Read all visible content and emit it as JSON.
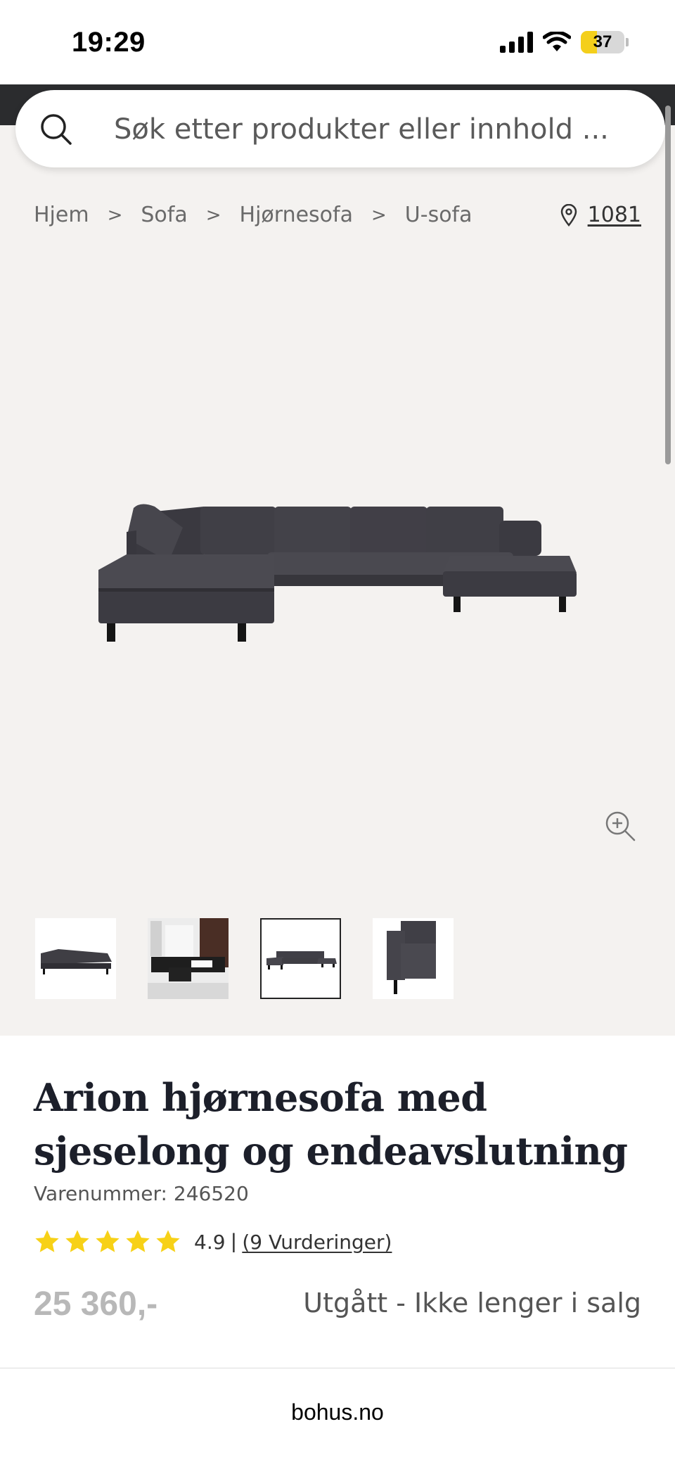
{
  "status_bar": {
    "time": "19:29",
    "battery": "37",
    "battery_level": 0.37,
    "icons": [
      "signal-icon",
      "wifi-icon",
      "battery-icon"
    ]
  },
  "search": {
    "placeholder": "Søk etter produkter eller innhold ...",
    "icon": "search-icon"
  },
  "breadcrumb": {
    "items": [
      "Hjem",
      "Sofa",
      "Hjørnesofa",
      "U-sofa"
    ],
    "separator": ">"
  },
  "store": {
    "label": "1081",
    "icon": "location-pin-icon"
  },
  "gallery": {
    "main_image": "dark-grey-u-sofa",
    "zoom_icon": "zoom-in-icon",
    "thumbnails": [
      "thumb-sofa-side",
      "thumb-livingroom",
      "thumb-sofa-front",
      "thumb-sofa-detail"
    ],
    "selected_index": 2
  },
  "product": {
    "title": "Arion hjørnesofa med sjeselong og endeavslutning",
    "sku": "Varenummer: 246520",
    "rating_value": "4.9",
    "rating_separator": "|",
    "rating_stars": 5,
    "review_link": "(9 Vurderinger)",
    "price": "25 360,-",
    "availability": "Utgått - Ikke lenger i salg"
  },
  "browser": {
    "url": "bohus.no"
  },
  "colors": {
    "header_dark": "#2b2c2e",
    "gallery_bg": "#f4f2f0",
    "star": "#f7d117",
    "price_grey": "#b8b8b8",
    "sofa": "#3f3e44"
  }
}
